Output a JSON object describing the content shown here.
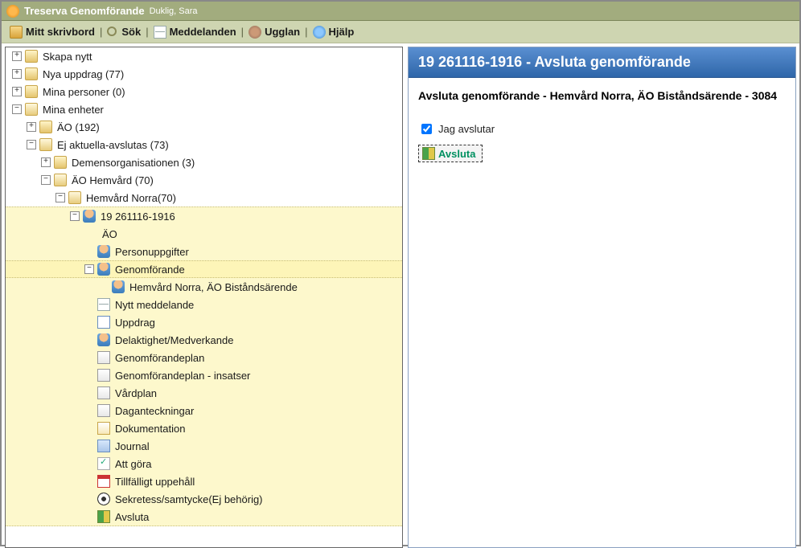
{
  "window": {
    "app_name": "Treserva Genomförande",
    "user": "Duklig, Sara"
  },
  "menu": {
    "desktop": "Mitt skrivbord",
    "search": "Sök",
    "messages": "Meddelanden",
    "ugglan": "Ugglan",
    "help": "Hjälp"
  },
  "tree": {
    "skapa_nytt": "Skapa nytt",
    "nya_uppdrag": "Nya uppdrag (77)",
    "mina_personer": "Mina personer (0)",
    "mina_enheter": "Mina enheter",
    "ao": "ÄO (192)",
    "ej_aktuella": "Ej aktuella-avslutas (73)",
    "demensorg": "Demensorganisationen (3)",
    "ao_hemvard": "ÄO Hemvård (70)",
    "hemvard_norra": "Hemvård Norra(70)",
    "person_id": "19 261116-1916",
    "ao_label": "ÄO",
    "personuppgifter": "Personuppgifter",
    "genomforande": "Genomförande",
    "genomforande_child": "Hemvård Norra, ÄO Biståndsärende",
    "nytt_meddelande": "Nytt meddelande",
    "uppdrag": "Uppdrag",
    "delaktighet": "Delaktighet/Medverkande",
    "genomforandeplan": "Genomförandeplan",
    "genomforandeplan_insatser": "Genomförandeplan - insatser",
    "vardplan": "Vårdplan",
    "daganteckningar": "Daganteckningar",
    "dokumentation": "Dokumentation",
    "journal": "Journal",
    "att_gora": "Att göra",
    "tillfalligt": "Tillfälligt uppehåll",
    "sekretess": "Sekretess/samtycke(Ej behörig)",
    "avsluta": "Avsluta"
  },
  "right": {
    "header": "19 261116-1916 - Avsluta genomförande",
    "sub": "Avsluta genomförande - Hemvård Norra, ÄO Biståndsärende - 3084",
    "checkbox_label": "Jag avslutar",
    "button_label": "Avsluta"
  }
}
